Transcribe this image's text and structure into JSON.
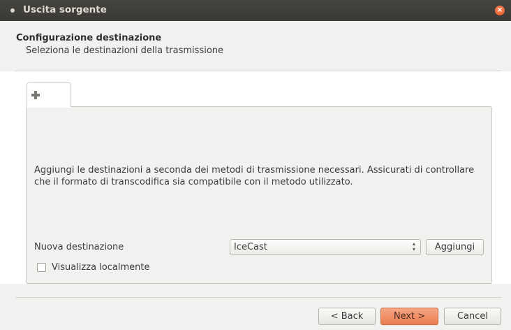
{
  "window": {
    "title": "Uscita sorgente",
    "close_symbol": "×"
  },
  "header": {
    "title": "Configurazione destinazione",
    "subtitle": "Seleziona le destinazioni della trasmissione"
  },
  "tabs": [
    {
      "icon": "plus-icon",
      "label": ""
    }
  ],
  "panel": {
    "description": "Aggiungi le destinazioni a seconda dei metodi di trasmissione necessari. Assicurati di controllare che il formato di transcodifica sia compatibile con il metodo utilizzato.",
    "new_destination_label": "Nuova destinazione",
    "destination_type_value": "IceCast",
    "add_button": "Aggiungi",
    "show_locally_label": "Visualizza localmente",
    "show_locally_checked": false
  },
  "footer": {
    "back_button": "< Back",
    "next_button": "Next >",
    "cancel_button": "Cancel"
  },
  "colors": {
    "titlebar": "#3e3d39",
    "close_button": "#e8541f",
    "next_button": "#ec7d50",
    "background": "#f2f1ef"
  }
}
